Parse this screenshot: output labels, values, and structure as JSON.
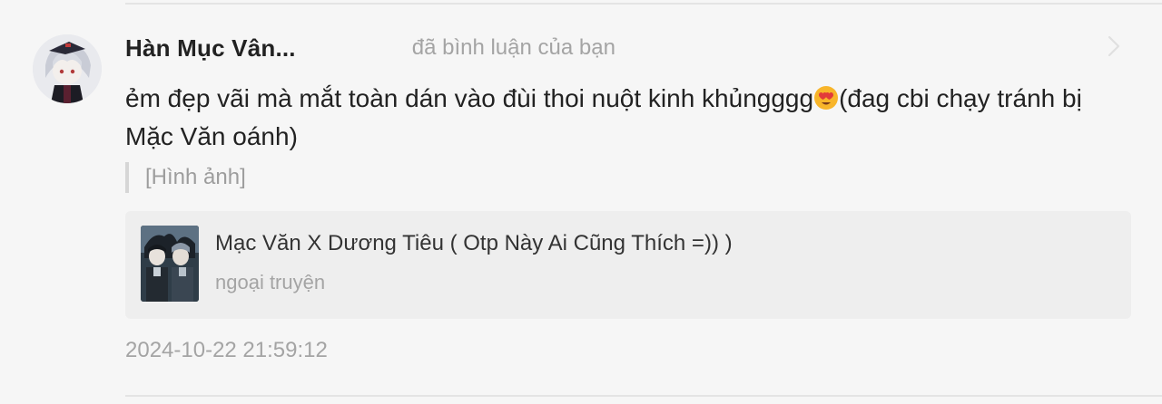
{
  "notification": {
    "username": "Hàn Mục Vân...",
    "action": "đã bình luận của bạn",
    "comment_before_emoji": "ẻm đẹp vãi mà mắt toàn dán vào đùi thoi nuột kinh khủngggg",
    "comment_after_emoji": "(đag cbi chạy tránh bị Mặc Văn oánh)",
    "emoji_icon": "heart-eyes-emoji",
    "quoted": "[Hình ảnh]",
    "card": {
      "title": "Mạc Văn X Dương Tiêu ( Otp Này Ai Cũng Thích =)) )",
      "subtitle": "ngoại truyện",
      "cover_icon": "story-cover-image"
    },
    "timestamp": "2024-10-22 21:59:12",
    "chevron_icon": "chevron-right-icon"
  },
  "colors": {
    "background": "#f6f6f6",
    "primary_text": "#222222",
    "secondary_text": "#a4a4a4",
    "card_background": "#eeeeee"
  }
}
